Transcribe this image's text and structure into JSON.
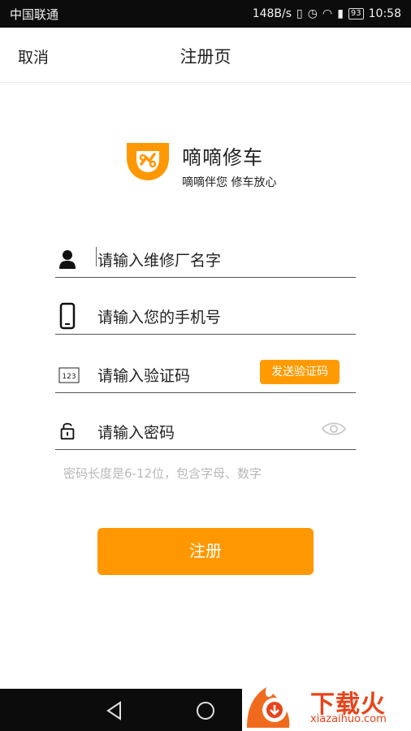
{
  "status_bar": {
    "carrier": "中国联通",
    "speed": "148B/s",
    "battery": "93",
    "time": "10:58"
  },
  "header": {
    "cancel_label": "取消",
    "title": "注册页"
  },
  "brand": {
    "name": "嘀嘀修车",
    "slogan": "嘀嘀伴您 修车放心"
  },
  "form": {
    "shop_name_placeholder": "请输入维修厂名字",
    "phone_placeholder": "请输入您的手机号",
    "code_placeholder": "请输入验证码",
    "send_code_label": "发送验证码",
    "password_placeholder": "请输入密码",
    "password_hint": "密码长度是6-12位，包含字母、数字"
  },
  "submit_label": "注册",
  "watermark": {
    "brand": "下载火",
    "domain": "xiazaihuo.com"
  },
  "colors": {
    "accent": "#ff9800",
    "status_bar": "#0c0c0c",
    "hint": "#b8b8b8"
  }
}
